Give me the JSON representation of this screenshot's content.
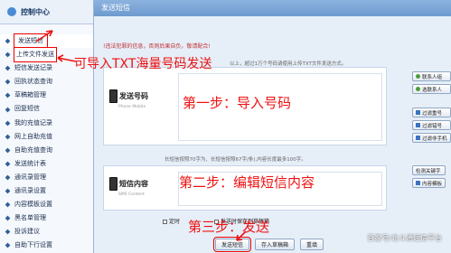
{
  "sidebar": {
    "title": "控制中心",
    "items": [
      {
        "label": "发送短信"
      },
      {
        "label": "上传文件发送"
      },
      {
        "label": "短信发送记录"
      },
      {
        "label": "回执状态查询"
      },
      {
        "label": "草稿箱管理"
      },
      {
        "label": "回复短信"
      },
      {
        "label": "我的充值记录"
      },
      {
        "label": "网上自助充值"
      },
      {
        "label": "自助充值查询"
      },
      {
        "label": "发送统计表"
      },
      {
        "label": "通讯录管理"
      },
      {
        "label": "通讯录设置"
      },
      {
        "label": "内容模板设置"
      },
      {
        "label": "黑名单管理"
      },
      {
        "label": "投诉建议"
      },
      {
        "label": "自助下行设置"
      }
    ]
  },
  "main": {
    "title": "发送短信",
    "notice": "!违法犯罪的信息，否则后果自负，敬请配合!",
    "hint1": "以上，超过1万个号码请使用上传TXT文件发送方式。",
    "hint2": "长短信按照70字为、长短信按照67字/条),内容长度最多100字。",
    "panel1_logo": {
      "name": "发送号码",
      "en": "Phone Mobile"
    },
    "panel2_logo": {
      "name": "短信内容",
      "en": "SMS Content"
    },
    "buttons1": [
      "联系人组",
      "选联系人",
      "过滤重号",
      "过滤错号",
      "过滤非手机"
    ],
    "buttons2": [
      "检测关键字",
      "内容模板"
    ],
    "opt_timer": "定时",
    "opt_save": "发送时保存到草稿箱",
    "actions": [
      "发送短信",
      "存入草稿箱",
      "重填"
    ]
  },
  "annotations": {
    "import": "可导入TXT海量号码发送",
    "step1": "第一步：导入号码",
    "step2": "第二步：编辑短信内容",
    "step3": "第三步：发送"
  },
  "watermark": "百家号/北斗通短信平台"
}
